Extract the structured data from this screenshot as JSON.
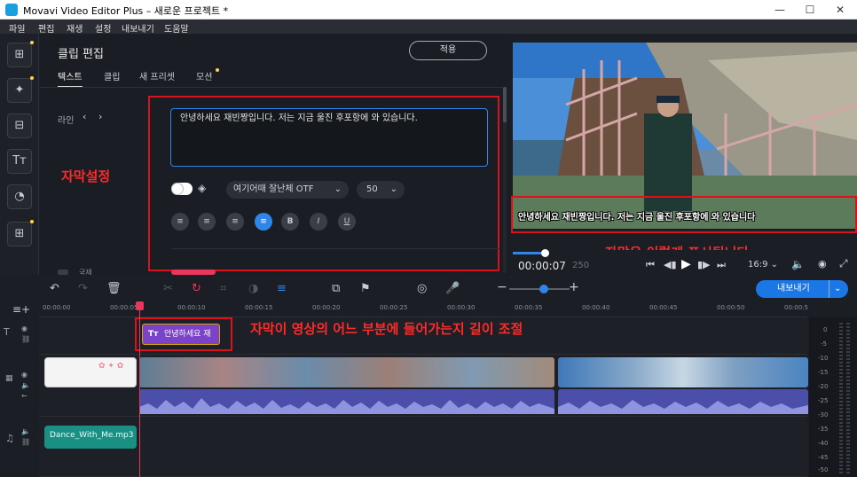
{
  "titlebar": {
    "title": "Movavi Video Editor Plus – 새로운 프로젝트 *",
    "min": "—",
    "max": "☐",
    "close": "✕"
  },
  "menu": [
    "파일",
    "편집",
    "재생",
    "설정",
    "내보내기",
    "도움말"
  ],
  "rail": {
    "icons": [
      "import-icon",
      "magic-filter-icon",
      "transition-icon",
      "title-icon",
      "sticker-icon",
      "more-tools-icon"
    ]
  },
  "panel": {
    "title": "클립 편집",
    "apply": "적용",
    "tabs": [
      "텍스트",
      "클립",
      "새 프리셋",
      "모션"
    ],
    "line_label": "라인",
    "text_value": "안녕하세요 재빈짱입니다. 저는 지금 울진 후포항에 와 있습니다.",
    "font": "여기어때 잘난체 OTF",
    "size": "50",
    "format_buttons": [
      "≡",
      "≡",
      "≡",
      "≡",
      "B",
      "I",
      "U"
    ],
    "partial_label": "국제"
  },
  "annotations": {
    "settings": "자막설정",
    "display": "자막은 이렇게 표시됩니다.",
    "length": "자막이 영상의 어느 부분에 들어가는지 길이 조절"
  },
  "preview": {
    "subtitle": "안녕하세요 재빈짱입니다. 저는 지금 울진 후포항에 와 있습니다",
    "time": "00:00:07",
    "time_extra": "250",
    "aspect": "16:9 ⌄"
  },
  "toolbar": {
    "export": "내보내기",
    "export_arrow": "⌄"
  },
  "ruler_ticks": [
    "00:00:00",
    "00:00:05",
    "00:00:10",
    "00:00:15",
    "00:00:20",
    "00:00:25",
    "00:00:30",
    "00:00:35",
    "00:00:40",
    "00:00:45",
    "00:00:50",
    "00:00:5"
  ],
  "title_clip": "안녕하세요 재",
  "audio_clip": "Dance_With_Me.mp3",
  "levels": [
    "0",
    "-5",
    "-10",
    "-15",
    "-20",
    "-25",
    "-30",
    "-35",
    "-40",
    "-45",
    "-50"
  ]
}
